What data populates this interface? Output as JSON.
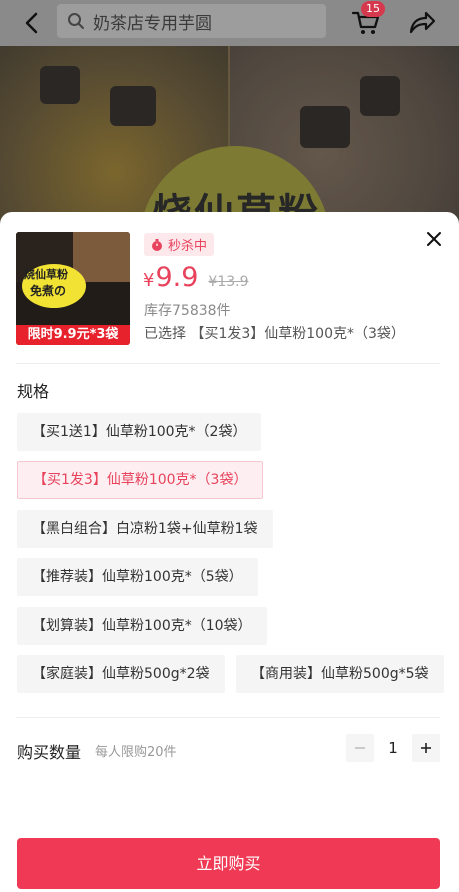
{
  "header": {
    "search_text": "奶茶店专用芋圆",
    "cart_count": "15"
  },
  "hero": {
    "title": "烧仙草粉"
  },
  "product": {
    "thumb_tag_line1": "烧仙草粉",
    "thumb_tag_line2": "免煮の",
    "thumb_banner": "限时9.9元*3袋",
    "flash_label": "秒杀中",
    "price_currency": "¥",
    "price": "9.9",
    "original_price": "¥13.9",
    "stock": "库存75838件",
    "selected": "已选择 【买1发3】仙草粉100克*（3袋）"
  },
  "spec": {
    "title": "规格",
    "options": [
      "【买1送1】仙草粉100克*（2袋）",
      "【买1发3】仙草粉100克*（3袋）",
      "【黑白组合】白凉粉1袋+仙草粉1袋",
      "【推荐装】仙草粉100克*（5袋）",
      "【划算装】仙草粉100克*（10袋）",
      "【家庭装】仙草粉500g*2袋",
      "【商用装】仙草粉500g*5袋"
    ],
    "selected_index": 1
  },
  "quantity": {
    "label": "购买数量",
    "limit": "每人限购20件",
    "value": "1",
    "minus": "−",
    "plus": "+"
  },
  "buy_button": "立即购买",
  "colors": {
    "accent": "#f03a55",
    "price": "#e8425c"
  }
}
